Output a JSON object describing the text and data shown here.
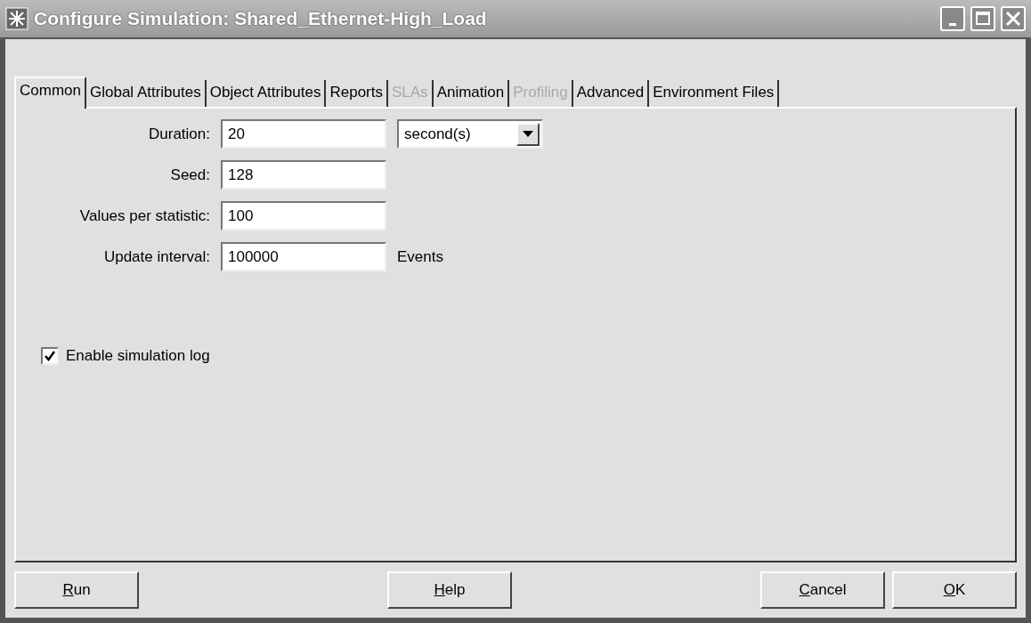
{
  "window": {
    "title": "Configure Simulation: Shared_Ethernet-High_Load"
  },
  "tabs": [
    {
      "label": "Common",
      "selected": true,
      "disabled": false
    },
    {
      "label": "Global Attributes",
      "selected": false,
      "disabled": false
    },
    {
      "label": "Object Attributes",
      "selected": false,
      "disabled": false
    },
    {
      "label": "Reports",
      "selected": false,
      "disabled": false
    },
    {
      "label": "SLAs",
      "selected": false,
      "disabled": true
    },
    {
      "label": "Animation",
      "selected": false,
      "disabled": false
    },
    {
      "label": "Profiling",
      "selected": false,
      "disabled": true
    },
    {
      "label": "Advanced",
      "selected": false,
      "disabled": false
    },
    {
      "label": "Environment Files",
      "selected": false,
      "disabled": false
    }
  ],
  "fields": [
    {
      "label": "Duration:",
      "value": "20",
      "unit_dropdown": "second(s)"
    },
    {
      "label": "Seed:",
      "value": "128"
    },
    {
      "label": "Values per statistic:",
      "value": "100"
    },
    {
      "label": "Update interval:",
      "value": "100000",
      "unit": "Events"
    }
  ],
  "log_checkbox": {
    "label": "Enable simulation log",
    "checked": true
  },
  "buttons": [
    {
      "label": "Run",
      "underline_first": true
    },
    {
      "label": "Help",
      "underline_first": true
    },
    {
      "label": "Cancel",
      "underline_first": true
    },
    {
      "label": "OK",
      "underline_first": true
    }
  ]
}
